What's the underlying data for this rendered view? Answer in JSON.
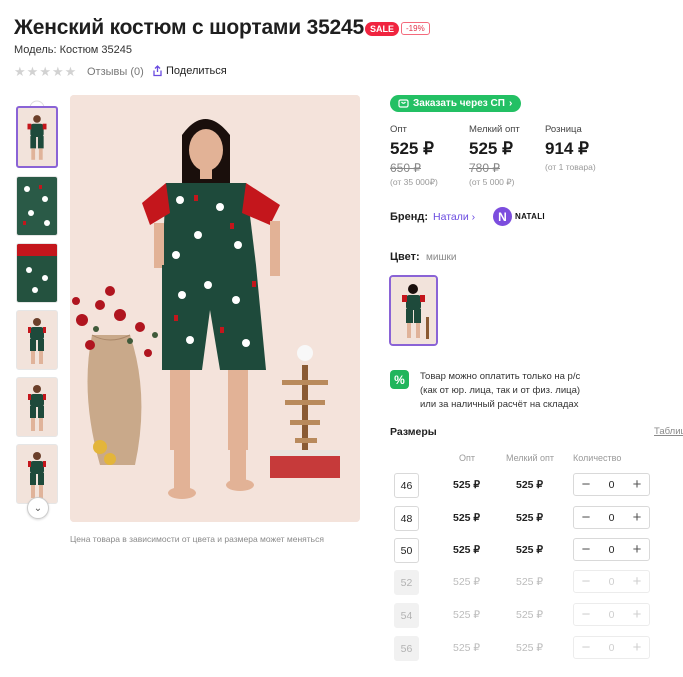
{
  "product": {
    "title": "Женский костюм с шортами 35245",
    "sale_badge": "SALE",
    "discount": "-19%",
    "model": "Модель: Костюм 35245",
    "reviews": "Отзывы (0)",
    "share": "Поделиться",
    "rating": 0,
    "caption": "Цена товара в зависимости от цвета и размера может меняться"
  },
  "purchase": {
    "sp_button": "Заказать через СП"
  },
  "prices": [
    {
      "label": "Опт",
      "price": "525 ₽",
      "old": "650 ₽",
      "note": "(от 35 000₽)"
    },
    {
      "label": "Мелкий опт",
      "price": "525 ₽",
      "old": "780 ₽",
      "note": "(от 5 000 ₽)"
    },
    {
      "label": "Розница",
      "price": "914 ₽",
      "old": "",
      "note": "(от 1 товара)"
    }
  ],
  "brand": {
    "label": "Бренд:",
    "name": "Натали",
    "logo_text": "NATALI",
    "logo_letter": "N"
  },
  "color": {
    "label": "Цвет:",
    "value": "мишки"
  },
  "payment_note": {
    "icon_text": "%",
    "lines": [
      "Товар можно оплатить только на р/с",
      "(как от юр. лица, так и от физ. лица)",
      "или за наличный расчёт на складах"
    ]
  },
  "sizes": {
    "title": "Размеры",
    "table_link": "Таблица",
    "headers": {
      "opt": "Опт",
      "small": "Мелкий опт",
      "qty": "Количество"
    },
    "rows": [
      {
        "size": "46",
        "opt": "525 ₽",
        "small": "525 ₽",
        "qty": "0",
        "available": true
      },
      {
        "size": "48",
        "opt": "525 ₽",
        "small": "525 ₽",
        "qty": "0",
        "available": true
      },
      {
        "size": "50",
        "opt": "525 ₽",
        "small": "525 ₽",
        "qty": "0",
        "available": true
      },
      {
        "size": "52",
        "opt": "525 ₽",
        "small": "525 ₽",
        "qty": "0",
        "available": false
      },
      {
        "size": "54",
        "opt": "525 ₽",
        "small": "525 ₽",
        "qty": "0",
        "available": false
      },
      {
        "size": "56",
        "opt": "525 ₽",
        "small": "525 ₽",
        "qty": "0",
        "available": false
      }
    ],
    "minus": "−",
    "plus": "+"
  },
  "colors": {
    "accent": "#8a63d6",
    "sale": "#f0243f",
    "green": "#23c064",
    "pajama": "#1e4a3b",
    "sleeve": "#c4161c"
  }
}
